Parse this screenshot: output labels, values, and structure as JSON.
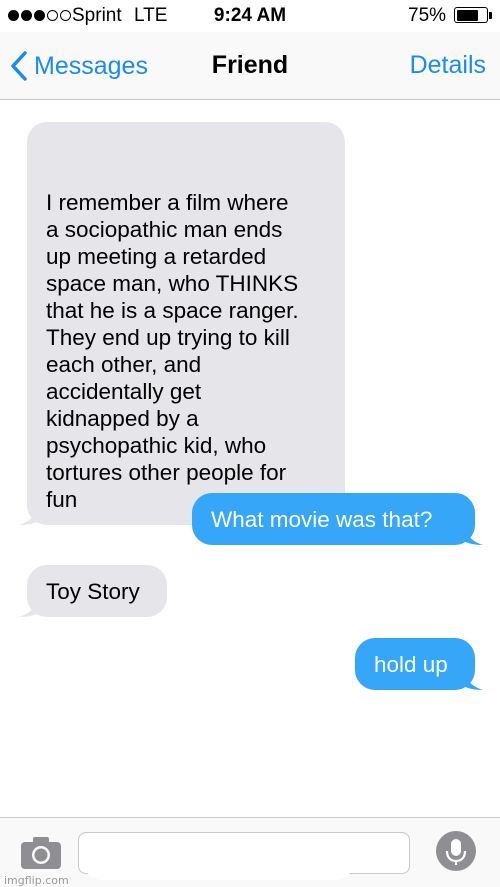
{
  "status_bar": {
    "carrier": "Sprint",
    "network": "LTE",
    "time": "9:24 AM",
    "battery": "75%",
    "battery_level": 0.75,
    "signal_bars": 3,
    "signal_total": 5
  },
  "nav": {
    "back_label": "Messages",
    "title": "Friend",
    "details_label": "Details",
    "back_icon": "chevron-left-icon"
  },
  "messages": [
    {
      "direction": "incoming",
      "text": "I remember a film where\na sociopathic man ends\nup meeting a retarded\nspace man, who THINKS\nthat he is a space ranger.\nThey end up trying to kill\neach other, and\naccidentally get\nkidnapped by a\npsychopathic kid, who\ntortures other people for\nfun"
    },
    {
      "direction": "outgoing",
      "text": "What movie was that?"
    },
    {
      "direction": "incoming",
      "text": "Toy Story"
    },
    {
      "direction": "outgoing",
      "text": "hold up"
    }
  ],
  "input_bar": {
    "camera_icon": "camera-icon",
    "mic_icon": "microphone-icon",
    "watermark": "imgflip.com"
  },
  "colors": {
    "accent": "#1a8cf0",
    "incoming_bubble": "#e5e5ea",
    "outgoing_bubble": "#35a6f8",
    "mic_button": "#8e8e93"
  }
}
